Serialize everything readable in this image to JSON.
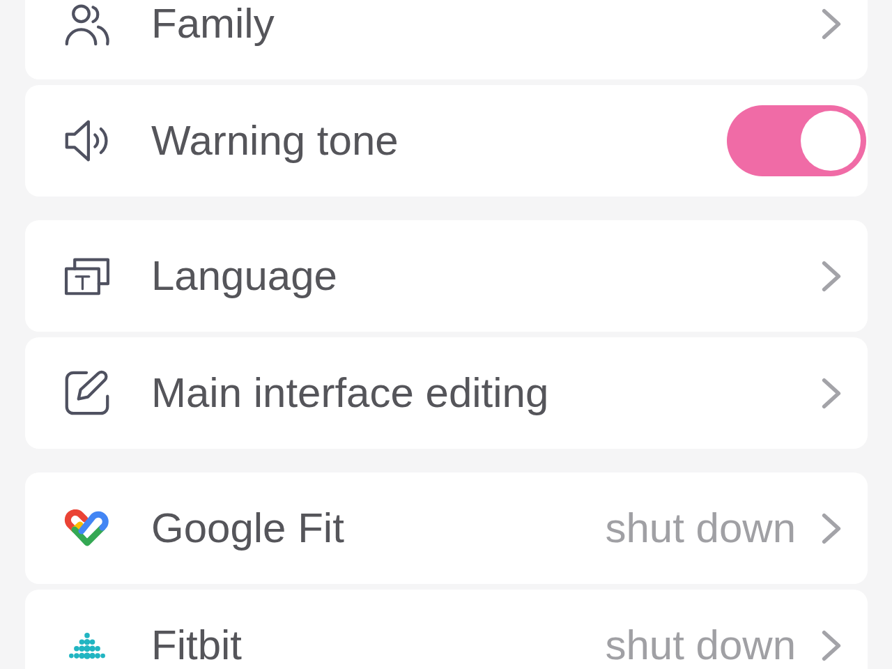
{
  "settings_groups": [
    {
      "items": [
        {
          "kind": "link",
          "label": "Family"
        },
        {
          "kind": "toggle",
          "label": "Warning tone",
          "on": true
        }
      ]
    },
    {
      "items": [
        {
          "kind": "link",
          "label": "Language"
        },
        {
          "kind": "link",
          "label": "Main interface editing"
        }
      ]
    },
    {
      "items": [
        {
          "kind": "link",
          "label": "Google Fit",
          "value": "shut down"
        },
        {
          "kind": "link",
          "label": "Fitbit",
          "value": "shut down"
        }
      ]
    }
  ]
}
